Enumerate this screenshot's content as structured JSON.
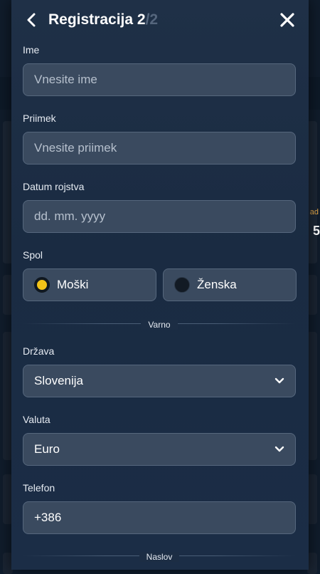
{
  "header": {
    "title": "Registracija 2",
    "step_total": "/2"
  },
  "form": {
    "first_name": {
      "label": "Ime",
      "placeholder": "Vnesite ime"
    },
    "last_name": {
      "label": "Priimek",
      "placeholder": "Vnesite priimek"
    },
    "birth_date": {
      "label": "Datum rojstva",
      "placeholder": "dd. mm. yyyy"
    },
    "gender": {
      "label": "Spol",
      "options": [
        {
          "label": "Moški",
          "selected": true
        },
        {
          "label": "Ženska",
          "selected": false
        }
      ]
    },
    "section_secure": "Varno",
    "country": {
      "label": "Država",
      "value": "Slovenija"
    },
    "currency": {
      "label": "Valuta",
      "value": "Euro"
    },
    "phone": {
      "label": "Telefon",
      "value": "+386"
    },
    "section_address": "Naslov"
  },
  "background": {
    "partial_text_1": "ad",
    "partial_text_2": "5"
  },
  "colors": {
    "radio_selected": "#f2c318",
    "field_bg": "#3a4a5f",
    "modal_bg": "#1f3047"
  },
  "icons": {
    "back": "chevron-left-icon",
    "close": "close-icon",
    "dropdown": "chevron-down-icon"
  }
}
